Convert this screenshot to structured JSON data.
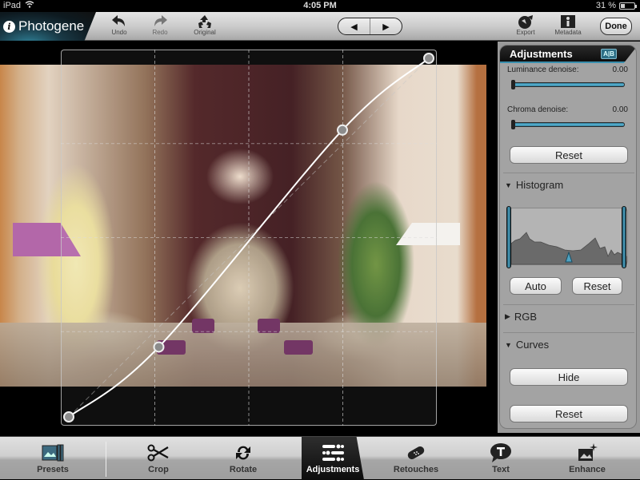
{
  "status_bar": {
    "device": "iPad",
    "time": "4:05 PM",
    "battery_text": "31 %",
    "battery_level": 0.31
  },
  "toolbar": {
    "app_title": "Photogene",
    "undo_label": "Undo",
    "redo_label": "Redo",
    "original_label": "Original",
    "prev_glyph": "◀",
    "next_glyph": "▶",
    "export_label": "Export",
    "metadata_label": "Metadata",
    "done_label": "Done"
  },
  "canvas": {
    "curve_points": [
      {
        "input": 0.0,
        "output": 0.0
      },
      {
        "input": 0.25,
        "output": 0.195
      },
      {
        "input": 0.76,
        "output": 0.8
      },
      {
        "input": 1.0,
        "output": 1.0
      }
    ]
  },
  "panel": {
    "title": "Adjustments",
    "ab_label": "A|B",
    "luminance_label": "Luminance denoise:",
    "luminance_value": "0.00",
    "luminance_level": 0.0,
    "chroma_label": "Chroma denoise:",
    "chroma_value": "0.00",
    "chroma_level": 0.0,
    "denoise_reset_label": "Reset",
    "histogram_label": "Histogram",
    "histogram_expanded": true,
    "histogram_black_point": 0.0,
    "histogram_white_point": 1.0,
    "histogram_midtone": 0.5,
    "histogram_auto_label": "Auto",
    "histogram_reset_label": "Reset",
    "rgb_label": "RGB",
    "rgb_expanded": false,
    "curves_label": "Curves",
    "curves_expanded": true,
    "curves_hide_label": "Hide",
    "curves_reset_label": "Reset"
  },
  "tabs": [
    {
      "id": "presets",
      "label": "Presets",
      "icon": "presets-icon",
      "active": false
    },
    {
      "id": "crop",
      "label": "Crop",
      "icon": "scissors-icon",
      "active": false
    },
    {
      "id": "rotate",
      "label": "Rotate",
      "icon": "rotate-icon",
      "active": false
    },
    {
      "id": "adjustments",
      "label": "Adjustments",
      "icon": "sliders-icon",
      "active": true
    },
    {
      "id": "retouches",
      "label": "Retouches",
      "icon": "bandage-icon",
      "active": false
    },
    {
      "id": "text",
      "label": "Text",
      "icon": "text-bubble-icon",
      "active": false
    },
    {
      "id": "enhance",
      "label": "Enhance",
      "icon": "enhance-icon",
      "active": false
    }
  ],
  "colors": {
    "accent": "#3a8fae",
    "slider": "#5bb8d8",
    "panel_bg": "#a3a3a3"
  }
}
